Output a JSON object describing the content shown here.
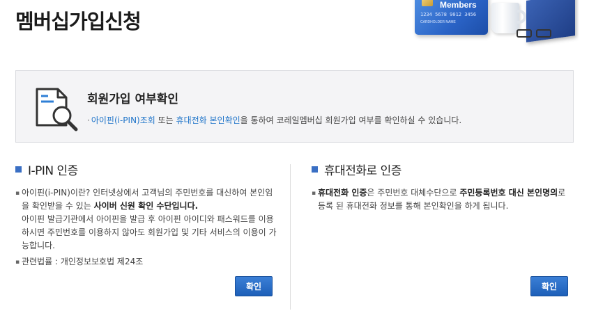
{
  "page": {
    "title": "멤버십가입신청"
  },
  "header_art": {
    "card_label": "Members",
    "card_number": "1234  5678  9012  3456",
    "card_holder": "CARDHOLDER NAME"
  },
  "info": {
    "title": "회원가입 여부확인",
    "desc_link1": "아이핀(i-PIN)조회",
    "desc_mid": " 또는 ",
    "desc_link2": "휴대전화 본인확인",
    "desc_end": "을 통하여 코레일멤버십 회원가입 여부를 확인하실 수 있습니다."
  },
  "ipin": {
    "title": "I-PIN 인증",
    "p1_a": "아이핀(i-PIN)이란? 인터넷상에서 고객님의 주민번호를 대신하여 본인임을 확인받을 수 있는 ",
    "p1_strong": "사이버 신원 확인 수단입니다.",
    "p1_b": "아이핀 발급기관에서 아이핀을 발급 후 아이핀 아이디와 패스워드를 이용하시면 주민번호를 이용하지 않아도 회원가입 및 기타 서비스의 이용이 가능합니다.",
    "law": "관련법률 : 개인정보보호법 제24조",
    "button": "확인"
  },
  "phone": {
    "title": "휴대전화로 인증",
    "p1_strong1": "휴대전화 인증",
    "p1_a": "은 주민번호 대체수단으로 ",
    "p1_strong2": "주민등록번호 대신 본인명의",
    "p1_b": "로 등록 된 휴대전화 정보를 통해 본인확인을 하게 됩니다.",
    "button": "확인"
  },
  "colors": {
    "accent": "#3a6fc4",
    "button": "#1d5fb8",
    "link": "#1f74c9"
  },
  "icons": {
    "info": "document-search-icon",
    "bullet": "square-bullet-icon"
  }
}
